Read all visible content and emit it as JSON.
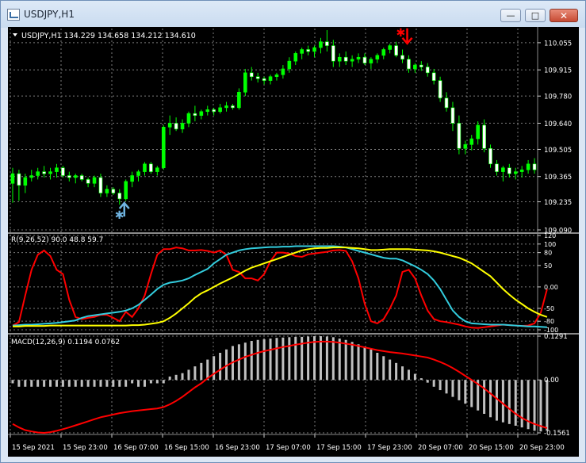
{
  "window": {
    "title": "USDJPY,H1",
    "buttons": {
      "minimize": "—",
      "maximize": "□",
      "close": "✕"
    }
  },
  "colors": {
    "background": "#000000",
    "grid": "#7a7a7a",
    "candle_bull": "#00ff00",
    "candle_bear": "#ffffff",
    "rsi_fast": "#ff0000",
    "rsi_mid": "#33ccdd",
    "rsi_slow": "#ffff00",
    "macd_hist": "#c0c0c0",
    "macd_signal": "#ff0000",
    "buy_arrow": "#6fb3e0",
    "sell_arrow": "#ff0000"
  },
  "price_panel": {
    "header": "USDJPY,H1  134.229 134.658 134.212 134.610",
    "axis_labels": [
      "110.055",
      "109.915",
      "109.780",
      "109.640",
      "109.505",
      "109.365",
      "109.235",
      "109.090"
    ]
  },
  "rsi_panel": {
    "header": "R(9,26,52) 90.0 48.8 59.7",
    "axis_labels": [
      "120",
      "100",
      "80",
      "50",
      "0.00",
      "-50",
      "-80",
      "-100"
    ]
  },
  "macd_panel": {
    "header": "MACD(12,26,9) 0.1194 0.0762",
    "axis_labels": [
      "0.1291",
      "0.00",
      "-0.1561"
    ]
  },
  "time_axis": [
    "15 Sep 2021",
    "15 Sep 23:00",
    "16 Sep 07:00",
    "16 Sep 15:00",
    "16 Sep 23:00",
    "17 Sep 07:00",
    "17 Sep 15:00",
    "17 Sep 23:00",
    "20 Sep 07:00",
    "20 Sep 15:00",
    "20 Sep 23:00"
  ],
  "chart_data": {
    "type": "candlestick",
    "price_range": [
      109.09,
      110.12
    ],
    "candles": [
      [
        109.33,
        109.41,
        109.23,
        109.38
      ],
      [
        109.38,
        109.4,
        109.24,
        109.32
      ],
      [
        109.32,
        109.38,
        109.28,
        109.36
      ],
      [
        109.36,
        109.4,
        109.34,
        109.37
      ],
      [
        109.37,
        109.41,
        109.35,
        109.39
      ],
      [
        109.39,
        109.42,
        109.36,
        109.38
      ],
      [
        109.38,
        109.41,
        109.35,
        109.39
      ],
      [
        109.39,
        109.43,
        109.36,
        109.41
      ],
      [
        109.41,
        109.42,
        109.36,
        109.37
      ],
      [
        109.37,
        109.39,
        109.34,
        109.36
      ],
      [
        109.36,
        109.38,
        109.33,
        109.37
      ],
      [
        109.37,
        109.38,
        109.34,
        109.35
      ],
      [
        109.35,
        109.36,
        109.31,
        109.33
      ],
      [
        109.33,
        109.37,
        109.31,
        109.36
      ],
      [
        109.36,
        109.38,
        109.26,
        109.28
      ],
      [
        109.28,
        109.32,
        109.26,
        109.3
      ],
      [
        109.3,
        109.31,
        109.27,
        109.28
      ],
      [
        109.28,
        109.3,
        109.22,
        109.25
      ],
      [
        109.25,
        109.35,
        109.24,
        109.34
      ],
      [
        109.34,
        109.39,
        109.31,
        109.37
      ],
      [
        109.37,
        109.4,
        109.34,
        109.39
      ],
      [
        109.39,
        109.44,
        109.37,
        109.43
      ],
      [
        109.43,
        109.44,
        109.38,
        109.39
      ],
      [
        109.39,
        109.42,
        109.37,
        109.41
      ],
      [
        109.41,
        109.63,
        109.4,
        109.62
      ],
      [
        109.62,
        109.68,
        109.58,
        109.64
      ],
      [
        109.64,
        109.67,
        109.6,
        109.61
      ],
      [
        109.61,
        109.66,
        109.59,
        109.64
      ],
      [
        109.64,
        109.7,
        109.62,
        109.69
      ],
      [
        109.69,
        109.73,
        109.65,
        109.68
      ],
      [
        109.68,
        109.71,
        109.66,
        109.7
      ],
      [
        109.7,
        109.73,
        109.68,
        109.71
      ],
      [
        109.71,
        109.72,
        109.68,
        109.7
      ],
      [
        109.7,
        109.74,
        109.69,
        109.72
      ],
      [
        109.72,
        109.75,
        109.7,
        109.73
      ],
      [
        109.73,
        109.74,
        109.71,
        109.72
      ],
      [
        109.72,
        109.82,
        109.71,
        109.8
      ],
      [
        109.8,
        109.92,
        109.78,
        109.9
      ],
      [
        109.9,
        109.93,
        109.86,
        109.88
      ],
      [
        109.88,
        109.9,
        109.85,
        109.87
      ],
      [
        109.87,
        109.88,
        109.84,
        109.86
      ],
      [
        109.86,
        109.89,
        109.84,
        109.88
      ],
      [
        109.88,
        109.9,
        109.86,
        109.89
      ],
      [
        109.89,
        109.94,
        109.87,
        109.92
      ],
      [
        109.92,
        109.98,
        109.9,
        109.96
      ],
      [
        109.96,
        110.01,
        109.94,
        110.0
      ],
      [
        110.0,
        110.03,
        109.97,
        110.02
      ],
      [
        110.02,
        110.04,
        109.99,
        110.01
      ],
      [
        110.01,
        110.04,
        109.98,
        110.03
      ],
      [
        110.03,
        110.08,
        110.0,
        110.06
      ],
      [
        110.06,
        110.12,
        110.01,
        110.04
      ],
      [
        110.04,
        110.07,
        109.93,
        109.96
      ],
      [
        109.96,
        110.0,
        109.93,
        109.98
      ],
      [
        109.98,
        110.01,
        109.94,
        109.96
      ],
      [
        109.96,
        109.99,
        109.93,
        109.97
      ],
      [
        109.97,
        110.0,
        109.95,
        109.98
      ],
      [
        109.98,
        110.0,
        109.94,
        109.95
      ],
      [
        109.95,
        109.98,
        109.92,
        109.97
      ],
      [
        109.97,
        110.0,
        109.95,
        109.99
      ],
      [
        109.99,
        110.03,
        109.97,
        110.02
      ],
      [
        110.02,
        110.05,
        110.0,
        110.04
      ],
      [
        110.04,
        110.06,
        109.98,
        109.99
      ],
      [
        109.99,
        110.02,
        109.95,
        109.97
      ],
      [
        109.97,
        109.99,
        109.9,
        109.92
      ],
      [
        109.92,
        109.95,
        109.9,
        109.94
      ],
      [
        109.94,
        109.96,
        109.91,
        109.93
      ],
      [
        109.93,
        109.95,
        109.88,
        109.9
      ],
      [
        109.9,
        109.92,
        109.84,
        109.86
      ],
      [
        109.86,
        109.88,
        109.75,
        109.77
      ],
      [
        109.77,
        109.8,
        109.7,
        109.72
      ],
      [
        109.72,
        109.75,
        109.6,
        109.64
      ],
      [
        109.64,
        109.68,
        109.48,
        109.51
      ],
      [
        109.51,
        109.55,
        109.48,
        109.53
      ],
      [
        109.53,
        109.58,
        109.5,
        109.56
      ],
      [
        109.56,
        109.65,
        109.53,
        109.63
      ],
      [
        109.63,
        109.66,
        109.49,
        109.51
      ],
      [
        109.51,
        109.53,
        109.41,
        109.43
      ],
      [
        109.43,
        109.45,
        109.37,
        109.39
      ],
      [
        109.39,
        109.42,
        109.34,
        109.41
      ],
      [
        109.41,
        109.43,
        109.36,
        109.38
      ],
      [
        109.38,
        109.41,
        109.35,
        109.39
      ],
      [
        109.39,
        109.42,
        109.36,
        109.4
      ],
      [
        109.4,
        109.45,
        109.38,
        109.43
      ],
      [
        109.43,
        109.46,
        109.38,
        109.4
      ]
    ],
    "markers": [
      {
        "type": "buy",
        "index": 17,
        "price": 109.2
      },
      {
        "type": "sell",
        "index": 62,
        "price": 110.08
      }
    ],
    "rsi_range": [
      -100,
      120
    ],
    "rsi_series": [
      {
        "values": [
          -90,
          -82,
          -20,
          40,
          75,
          85,
          72,
          40,
          30,
          -30,
          -70,
          -75,
          -72,
          -70,
          -65,
          -65,
          -72,
          -80,
          -58,
          -70,
          -50,
          -20,
          30,
          75,
          88,
          88,
          92,
          90,
          85,
          85,
          86,
          84,
          80,
          85,
          75,
          40,
          35,
          20,
          20,
          15,
          30,
          60,
          80,
          80,
          78,
          72,
          70,
          76,
          78,
          80,
          82,
          85,
          86,
          84,
          60,
          20,
          -40,
          -80,
          -85,
          -75,
          -50,
          -20,
          35,
          40,
          20,
          -20,
          -55,
          -75,
          -80,
          -82,
          -85,
          -88,
          -92,
          -95,
          -96,
          -94,
          -92,
          -90,
          -88,
          -89,
          -90,
          -91,
          -90,
          -85,
          -60,
          -5
        ]
      },
      {
        "values": [
          -90,
          -89,
          -88,
          -88,
          -87,
          -86,
          -85,
          -84,
          -82,
          -80,
          -78,
          -72,
          -68,
          -66,
          -64,
          -62,
          -60,
          -58,
          -55,
          -50,
          -42,
          -30,
          -18,
          -5,
          5,
          10,
          12,
          15,
          20,
          28,
          35,
          42,
          55,
          65,
          75,
          80,
          85,
          88,
          90,
          91,
          92,
          93,
          93,
          94,
          94,
          95,
          95,
          95,
          95,
          95,
          95,
          95,
          94,
          92,
          88,
          84,
          80,
          76,
          72,
          68,
          66,
          66,
          62,
          55,
          48,
          40,
          30,
          15,
          -5,
          -30,
          -55,
          -70,
          -80,
          -85,
          -86,
          -87,
          -88,
          -88,
          -88,
          -89,
          -90,
          -91,
          -92,
          -92,
          -93,
          -94
        ]
      },
      {
        "values": [
          -92,
          -92,
          -91,
          -91,
          -91,
          -91,
          -90,
          -90,
          -90,
          -90,
          -90,
          -90,
          -90,
          -90,
          -90,
          -90,
          -90,
          -90,
          -90,
          -89,
          -89,
          -88,
          -86,
          -84,
          -80,
          -72,
          -62,
          -50,
          -38,
          -25,
          -15,
          -8,
          0,
          8,
          15,
          22,
          30,
          38,
          45,
          50,
          55,
          60,
          65,
          70,
          75,
          80,
          85,
          88,
          90,
          91,
          91,
          92,
          92,
          92,
          91,
          90,
          88,
          86,
          86,
          87,
          88,
          88,
          88,
          88,
          87,
          86,
          85,
          83,
          80,
          76,
          72,
          68,
          62,
          55,
          45,
          35,
          25,
          10,
          -5,
          -18,
          -30,
          -40,
          -50,
          -58,
          -65,
          -70
        ]
      }
    ],
    "macd_range": [
      -0.1561,
      0.1291
    ],
    "macd_histogram": [
      -0.01,
      -0.02,
      -0.02,
      -0.02,
      -0.02,
      -0.02,
      -0.02,
      -0.02,
      -0.02,
      -0.02,
      -0.02,
      -0.02,
      -0.02,
      -0.02,
      -0.02,
      -0.02,
      -0.02,
      -0.02,
      -0.02,
      -0.01,
      -0.02,
      -0.02,
      -0.01,
      -0.01,
      -0.01,
      0.01,
      0.015,
      0.02,
      0.03,
      0.04,
      0.05,
      0.06,
      0.07,
      0.08,
      0.09,
      0.1,
      0.105,
      0.11,
      0.115,
      0.118,
      0.12,
      0.122,
      0.124,
      0.125,
      0.126,
      0.127,
      0.127,
      0.128,
      0.129,
      0.129,
      0.128,
      0.126,
      0.122,
      0.118,
      0.112,
      0.105,
      0.098,
      0.09,
      0.08,
      0.07,
      0.06,
      0.05,
      0.04,
      0.03,
      0.018,
      0.005,
      -0.008,
      -0.02,
      -0.03,
      -0.04,
      -0.05,
      -0.06,
      -0.07,
      -0.08,
      -0.09,
      -0.1,
      -0.11,
      -0.12,
      -0.125,
      -0.13,
      -0.135,
      -0.14,
      -0.145,
      -0.15,
      -0.152,
      -0.15
    ],
    "macd_signal": [
      -0.13,
      -0.14,
      -0.148,
      -0.152,
      -0.155,
      -0.156,
      -0.154,
      -0.15,
      -0.145,
      -0.14,
      -0.134,
      -0.128,
      -0.122,
      -0.116,
      -0.11,
      -0.106,
      -0.102,
      -0.098,
      -0.095,
      -0.092,
      -0.09,
      -0.088,
      -0.086,
      -0.084,
      -0.08,
      -0.072,
      -0.062,
      -0.05,
      -0.036,
      -0.022,
      -0.01,
      0.005,
      0.018,
      0.03,
      0.042,
      0.052,
      0.06,
      0.068,
      0.074,
      0.08,
      0.085,
      0.089,
      0.093,
      0.097,
      0.1,
      0.104,
      0.107,
      0.11,
      0.112,
      0.113,
      0.113,
      0.112,
      0.11,
      0.107,
      0.104,
      0.1,
      0.096,
      0.092,
      0.088,
      0.085,
      0.082,
      0.08,
      0.078,
      0.075,
      0.072,
      0.069,
      0.066,
      0.06,
      0.053,
      0.045,
      0.035,
      0.024,
      0.012,
      0.0,
      -0.012,
      -0.025,
      -0.04,
      -0.055,
      -0.07,
      -0.085,
      -0.1,
      -0.112,
      -0.122,
      -0.13,
      -0.136,
      -0.142
    ]
  }
}
